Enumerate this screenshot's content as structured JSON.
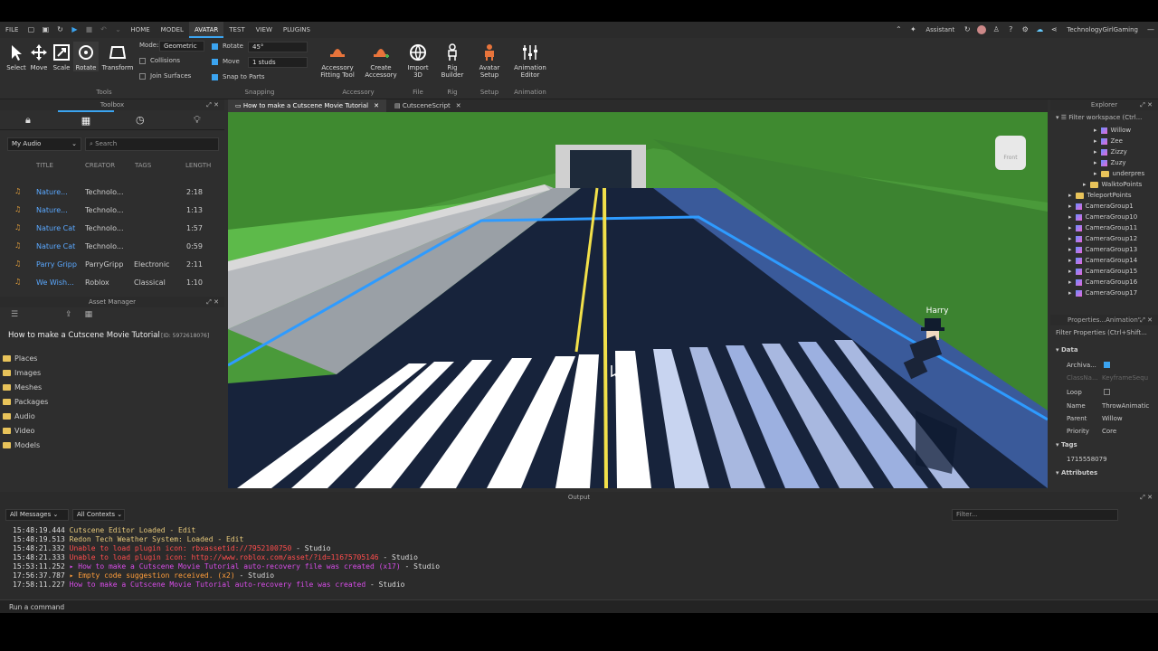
{
  "menu": {
    "items": [
      "FILE",
      "HOME",
      "MODEL",
      "AVATAR",
      "TEST",
      "VIEW",
      "PLUGINS"
    ],
    "active_index": 3,
    "assistant": "Assistant",
    "username": "TechnologyGirlGaming"
  },
  "ribbon": {
    "tools": [
      {
        "label": "Select",
        "icon": "cursor-icon"
      },
      {
        "label": "Move",
        "icon": "move-icon"
      },
      {
        "label": "Scale",
        "icon": "scale-icon"
      },
      {
        "label": "Rotate",
        "icon": "rotate-icon"
      },
      {
        "label": "Transform",
        "icon": "transform-icon"
      }
    ],
    "tools_group": "Tools",
    "mode_label": "Mode:",
    "mode_value": "Geometric",
    "collisions": "Collisions",
    "join_surfaces": "Join Surfaces",
    "rotate_label": "Rotate",
    "rotate_value": "45°",
    "move_label": "Move",
    "move_value": "1 studs",
    "snap_to_parts": "Snap to Parts",
    "snapping_group": "Snapping",
    "accessory_fitting": [
      "Accessory",
      "Fitting Tool"
    ],
    "create_accessory": [
      "Create",
      "Accessory"
    ],
    "accessory_group": "Accessory",
    "import3d": [
      "Import",
      "3D"
    ],
    "file_group": "File",
    "rig_builder": [
      "Rig",
      "Builder"
    ],
    "rig_group": "Rig",
    "avatar_setup": [
      "Avatar",
      "Setup"
    ],
    "setup_group": "Setup",
    "animation_editor": [
      "Animation",
      "Editor"
    ],
    "animation_group": "Animation"
  },
  "toolbox": {
    "title": "Toolbox",
    "dropdown": "My Audio",
    "search_placeholder": "Search",
    "columns": [
      "TITLE",
      "CREATOR",
      "TAGS",
      "LENGTH"
    ],
    "rows": [
      {
        "title": "Nature...",
        "creator": "Technolo...",
        "tags": "",
        "length": "2:18"
      },
      {
        "title": "Nature...",
        "creator": "Technolo...",
        "tags": "",
        "length": "1:13"
      },
      {
        "title": "Nature Cat",
        "creator": "Technolo...",
        "tags": "",
        "length": "1:57"
      },
      {
        "title": "Nature Cat",
        "creator": "Technolo...",
        "tags": "",
        "length": "0:59"
      },
      {
        "title": "Parry Gripp",
        "creator": "ParryGripp",
        "tags": "Electronic",
        "length": "2:11"
      },
      {
        "title": "We Wish...",
        "creator": "Roblox",
        "tags": "Classical",
        "length": "1:10"
      }
    ]
  },
  "asset_manager": {
    "title": "Asset Manager",
    "project": "How to make a Cutscene Movie Tutorial",
    "id": "[ID: 5972618076]",
    "folders": [
      "Places",
      "Images",
      "Meshes",
      "Packages",
      "Audio",
      "Video",
      "Models"
    ]
  },
  "tabs": [
    {
      "label": "How to make a Cutscene Movie Tutorial"
    },
    {
      "label": "CutsceneScript"
    }
  ],
  "viewport": {
    "character_name": "Harry",
    "cube_label": "Front"
  },
  "explorer": {
    "title": "Explorer",
    "filter": "Filter workspace (Ctrl...",
    "items": [
      "Willow",
      "Zee",
      "Zizzy",
      "Zuzy",
      "underpres",
      "WalktoPoints",
      "TeleportPoints",
      "CameraGroup1",
      "CameraGroup10",
      "CameraGroup11",
      "CameraGroup12",
      "CameraGroup13",
      "CameraGroup14",
      "CameraGroup15",
      "CameraGroup16",
      "CameraGroup17"
    ]
  },
  "properties": {
    "title": "Properties...Animation\"",
    "filter": "Filter Properties (Ctrl+Shift...",
    "data_section": "Data",
    "archivable": "Archiva...",
    "classname": "ClassNa...",
    "classname_value": "KeyframeSequ",
    "loop": "Loop",
    "name_label": "Name",
    "name_value": "ThrowAnimatic",
    "parent_label": "Parent",
    "parent_value": "Willow",
    "priority_label": "Priority",
    "priority_value": "Core",
    "tags_section": "Tags",
    "tag_value": "1715558079",
    "attributes_section": "Attributes"
  },
  "output": {
    "title": "Output",
    "all_messages": "All Messages",
    "all_contexts": "All Contexts",
    "filter_placeholder": "Filter...",
    "lines": [
      {
        "time": "15:48:19.444",
        "text": "Cutscene Editor Loaded  -  Edit",
        "color": "#e6c87a",
        "src": ""
      },
      {
        "time": "15:48:19.513",
        "text": "Redon Tech Weather System: Loaded  -  Edit",
        "color": "#e6c87a",
        "src": ""
      },
      {
        "time": "15:48:21.332",
        "text": "Unable to load plugin icon: rbxassetid://7952100750",
        "color": "#ff4d4d",
        "src": "  -  Studio"
      },
      {
        "time": "15:48:21.333",
        "text": "Unable to load plugin icon: http://www.roblox.com/asset/?id=11675705146",
        "color": "#ff4d4d",
        "src": "  -  Studio"
      },
      {
        "time": "15:53:11.252",
        "text": "▸ How to make a Cutscene Movie Tutorial auto-recovery file was created (x17)",
        "color": "#d74ce8",
        "src": "  -  Studio"
      },
      {
        "time": "17:56:37.787",
        "text": "▸ Empty code suggestion received. (x2)",
        "color": "#ff9d3a",
        "src": "  -  Studio"
      },
      {
        "time": "17:58:11.227",
        "text": "How to make a Cutscene Movie Tutorial auto-recovery file was created",
        "color": "#d74ce8",
        "src": "  -  Studio"
      }
    ],
    "command_placeholder": "Run a command"
  }
}
